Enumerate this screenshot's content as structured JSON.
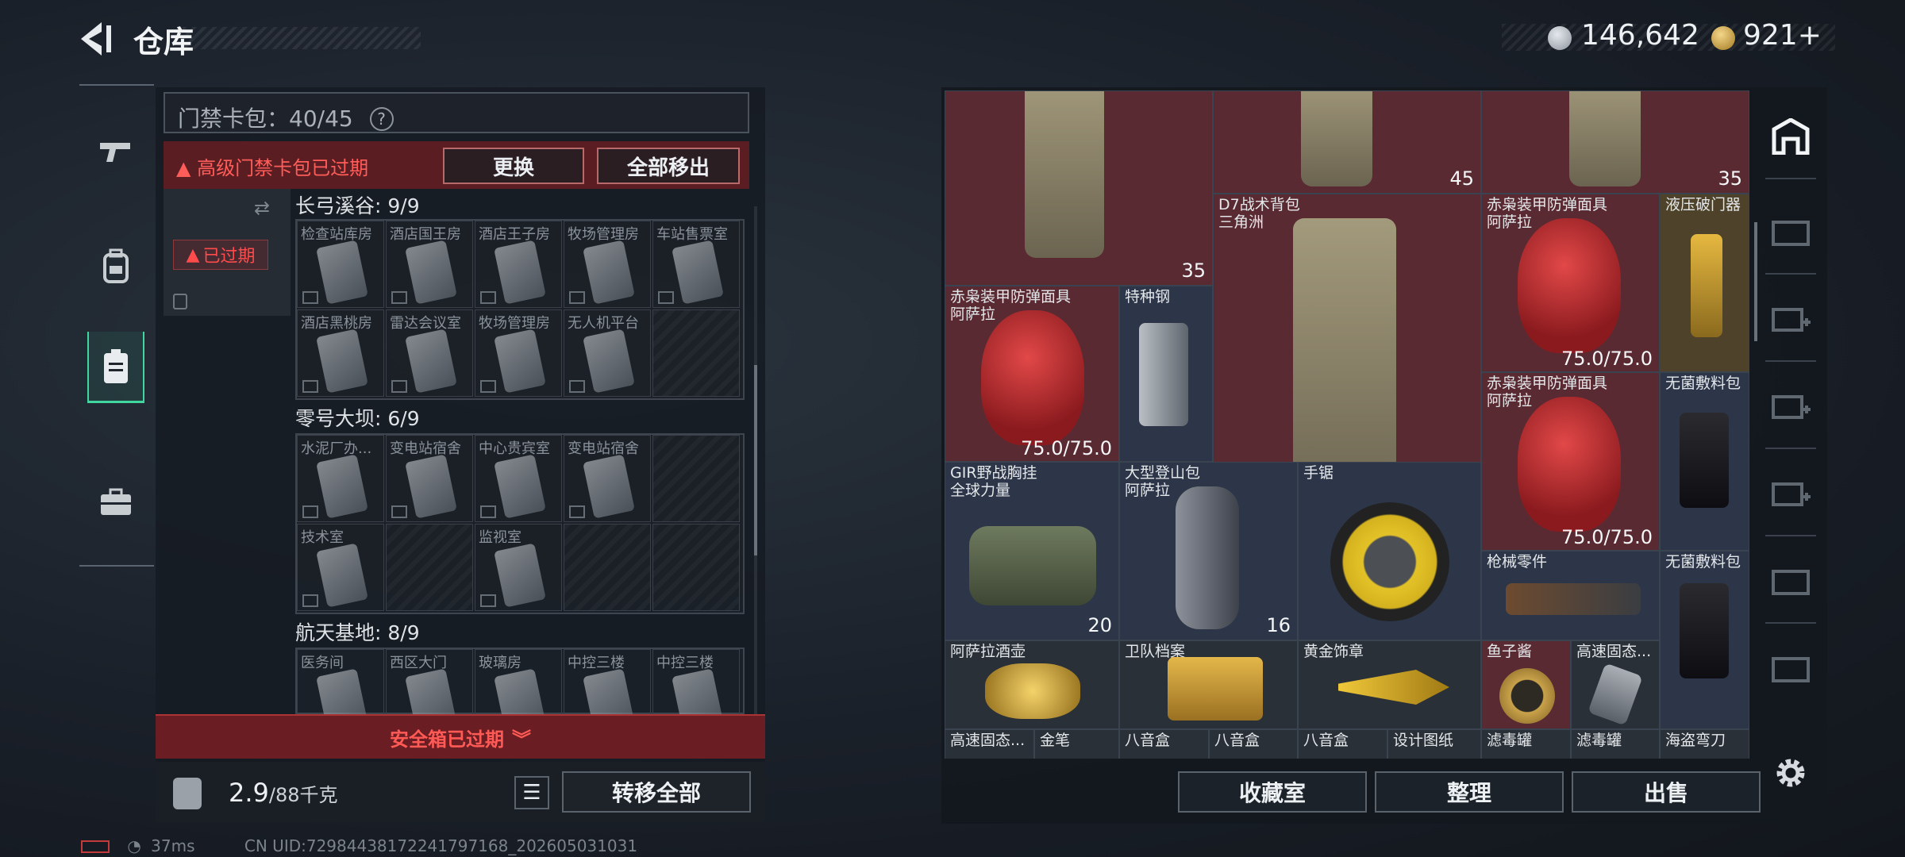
{
  "header": {
    "title": "仓库"
  },
  "currency": {
    "silver": "146,642",
    "gold": "921+"
  },
  "left": {
    "keycard_label": "门禁卡包：40/45",
    "help": "?",
    "warning": "高级门禁卡包已过期",
    "swap_button": "更换",
    "remove_all_button": "全部移出",
    "expired_badge": "已过期",
    "sections": [
      {
        "title": "长弓溪谷: 9/9",
        "slots": [
          "检查站库房",
          "酒店国王房",
          "酒店王子房",
          "牧场管理房",
          "车站售票室",
          "酒店黑桃房",
          "雷达会议室",
          "牧场管理房",
          "无人机平台",
          ""
        ]
      },
      {
        "title": "零号大坝: 6/9",
        "slots": [
          "水泥厂办...",
          "变电站宿舍",
          "中心贵宾室",
          "变电站宿舍",
          "",
          "技术室",
          "",
          "监视室",
          "",
          ""
        ]
      },
      {
        "title": "航天基地: 8/9",
        "slots": [
          "医务间",
          "西区大门",
          "玻璃房",
          "中控三楼",
          "中控三楼"
        ]
      }
    ],
    "safe_box": "安全箱已过期",
    "weight_value": "2.9",
    "weight_cap": "/88千克",
    "transfer_all_button": "转移全部"
  },
  "inventory": {
    "top_counts": [
      "35",
      "45",
      "35"
    ],
    "items": [
      {
        "name": "D7战术背包\n三角洲",
        "count": "35"
      },
      {
        "name": "赤枭装甲防弹面具\n阿萨拉",
        "durability": "75.0/75.0"
      },
      {
        "name": "液压破门器"
      },
      {
        "name": "赤枭装甲防弹面具\n阿萨拉",
        "durability": "75.0/75.0"
      },
      {
        "name": "特种钢"
      },
      {
        "name": "赤枭装甲防弹面具\n阿萨拉",
        "durability": "75.0/75.0"
      },
      {
        "name": "无菌敷料包"
      },
      {
        "name": "GIR野战胸挂\n全球力量",
        "count": "20"
      },
      {
        "name": "大型登山包\n阿萨拉",
        "count": "16"
      },
      {
        "name": "手锯"
      },
      {
        "name": "枪械零件"
      },
      {
        "name": "无菌敷料包"
      },
      {
        "name": "阿萨拉酒壶"
      },
      {
        "name": "卫队档案"
      },
      {
        "name": "黄金饰章"
      },
      {
        "name": "鱼子酱"
      },
      {
        "name": "高速固态..."
      }
    ],
    "bottom_row": [
      "高速固态...",
      "金笔",
      "八音盒",
      "八音盒",
      "八音盒",
      "设计图纸",
      "滤毒罐",
      "滤毒罐",
      "海盗弯刀"
    ]
  },
  "right_buttons": {
    "collection": "收藏室",
    "sort": "整理",
    "sell": "出售"
  },
  "status": {
    "ping": "37ms",
    "uid": "CN UID:7298443817224179716​8_202605031031"
  },
  "colors": {
    "accent": "#3fd6a0",
    "warning": "#ff5d5a"
  },
  "icons": [
    "back-arrow-icon",
    "gun-icon",
    "backpack-icon",
    "locker-icon",
    "briefcase-icon",
    "list-icon",
    "gear-icon",
    "swap-icon",
    "lock-icon",
    "wifi-icon",
    "battery-icon"
  ]
}
